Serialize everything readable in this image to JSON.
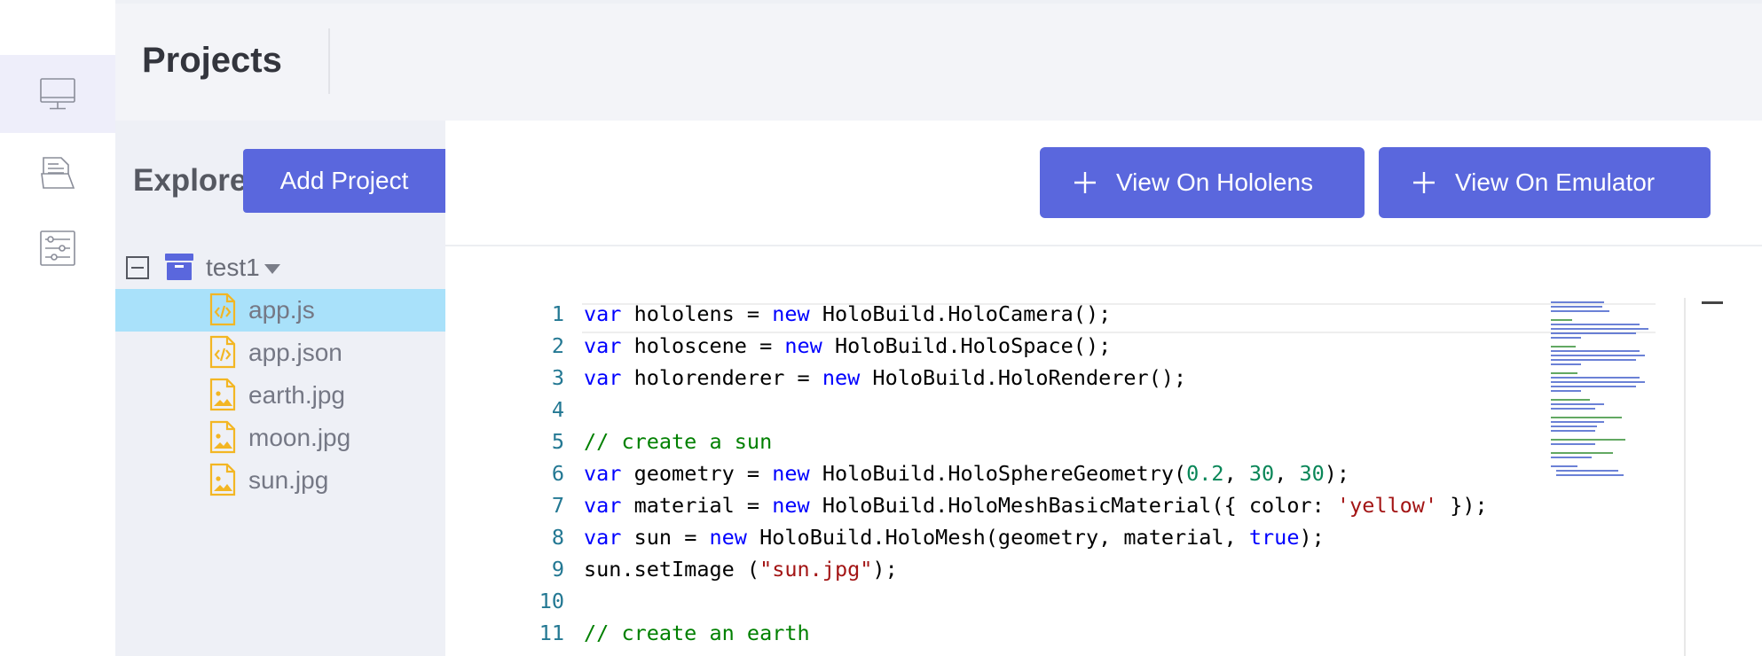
{
  "header": {
    "title": "Projects"
  },
  "rail": {
    "items": [
      {
        "icon": "monitor-icon",
        "active": true
      },
      {
        "icon": "documents-icon",
        "active": false
      },
      {
        "icon": "sliders-icon",
        "active": false
      }
    ]
  },
  "explorer": {
    "label": "Explore",
    "add_project_label": "Add Project",
    "folder": {
      "name": "test1"
    },
    "files": [
      {
        "name": "app.js",
        "type": "code",
        "selected": true
      },
      {
        "name": "app.json",
        "type": "code",
        "selected": false
      },
      {
        "name": "earth.jpg",
        "type": "image",
        "selected": false
      },
      {
        "name": "moon.jpg",
        "type": "image",
        "selected": false
      },
      {
        "name": "sun.jpg",
        "type": "image",
        "selected": false
      }
    ]
  },
  "toolbar": {
    "view_hololens_label": "View On Hololens",
    "view_emulator_label": "View On Emulator"
  },
  "editor": {
    "lines": [
      {
        "n": "1",
        "tokens": [
          [
            "kw",
            "var"
          ],
          [
            "p",
            " hololens = "
          ],
          [
            "kw",
            "new"
          ],
          [
            "p",
            " HoloBuild.HoloCamera();"
          ]
        ]
      },
      {
        "n": "2",
        "tokens": [
          [
            "kw",
            "var"
          ],
          [
            "p",
            " holoscene = "
          ],
          [
            "kw",
            "new"
          ],
          [
            "p",
            " HoloBuild.HoloSpace();"
          ]
        ]
      },
      {
        "n": "3",
        "tokens": [
          [
            "kw",
            "var"
          ],
          [
            "p",
            " holorenderer = "
          ],
          [
            "kw",
            "new"
          ],
          [
            "p",
            " HoloBuild.HoloRenderer();"
          ]
        ]
      },
      {
        "n": "4",
        "tokens": []
      },
      {
        "n": "5",
        "tokens": [
          [
            "cm",
            "// create a sun"
          ]
        ]
      },
      {
        "n": "6",
        "tokens": [
          [
            "kw",
            "var"
          ],
          [
            "p",
            " geometry = "
          ],
          [
            "kw",
            "new"
          ],
          [
            "p",
            " HoloBuild.HoloSphereGeometry("
          ],
          [
            "num",
            "0.2"
          ],
          [
            "p",
            ", "
          ],
          [
            "num",
            "30"
          ],
          [
            "p",
            ", "
          ],
          [
            "num",
            "30"
          ],
          [
            "p",
            ");"
          ]
        ]
      },
      {
        "n": "7",
        "tokens": [
          [
            "kw",
            "var"
          ],
          [
            "p",
            " material = "
          ],
          [
            "kw",
            "new"
          ],
          [
            "p",
            " HoloBuild.HoloMeshBasicMaterial({ color: "
          ],
          [
            "str",
            "'yellow'"
          ],
          [
            "p",
            " });"
          ]
        ]
      },
      {
        "n": "8",
        "tokens": [
          [
            "kw",
            "var"
          ],
          [
            "p",
            " sun = "
          ],
          [
            "kw",
            "new"
          ],
          [
            "p",
            " HoloBuild.HoloMesh(geometry, material, "
          ],
          [
            "kw",
            "true"
          ],
          [
            "p",
            ");"
          ]
        ]
      },
      {
        "n": "9",
        "tokens": [
          [
            "p",
            "sun.setImage ("
          ],
          [
            "str",
            "\"sun.jpg\""
          ],
          [
            "p",
            ");"
          ]
        ]
      },
      {
        "n": "10",
        "tokens": []
      },
      {
        "n": "11",
        "tokens": [
          [
            "cm",
            "// create an earth"
          ]
        ]
      }
    ]
  },
  "colors": {
    "accent": "#5a67dd",
    "selected_row": "#a9e1fa",
    "file_icon": "#f3b623",
    "folder_icon": "#5a67dd"
  }
}
